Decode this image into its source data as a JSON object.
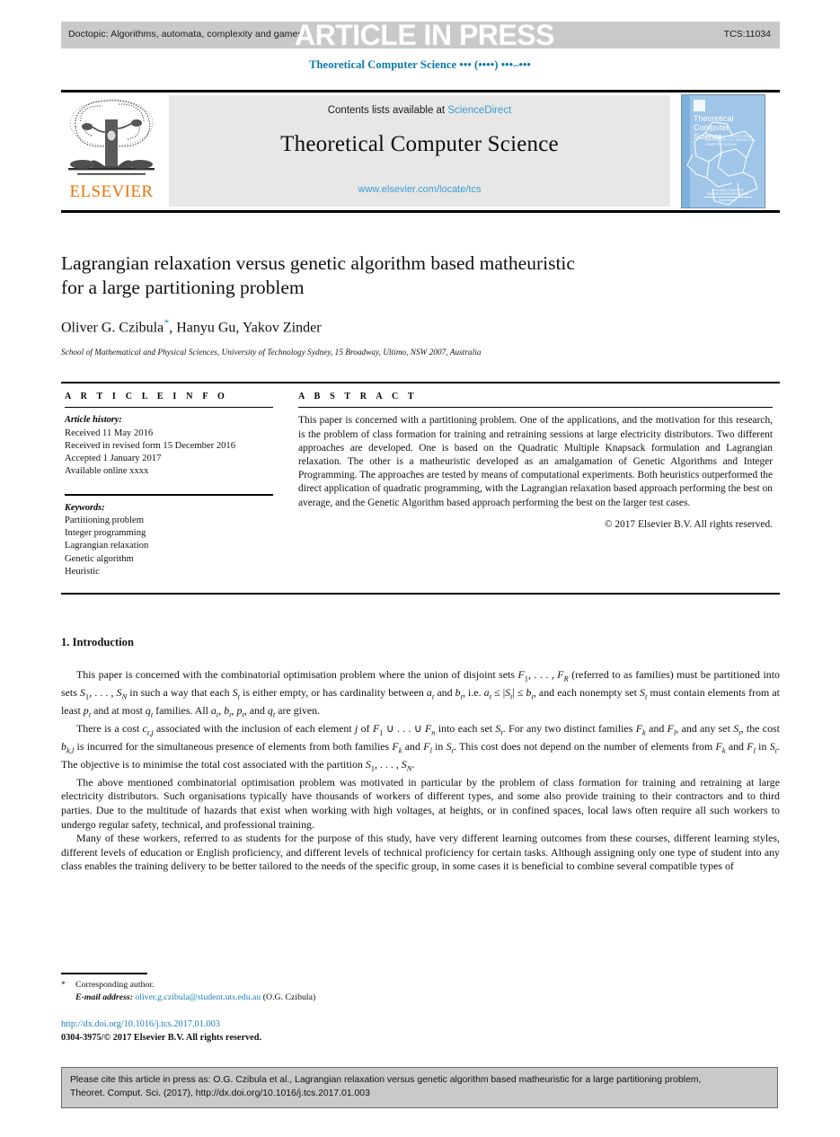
{
  "header": {
    "doctopic": "Doctopic: Algorithms, automata, complexity and games",
    "article_in_press": "ARTICLE IN PRESS",
    "tcs_number": "TCS:11034",
    "running_head": "Theoretical Computer Science ••• (••••) •••–•••"
  },
  "masthead": {
    "publisher": "ELSEVIER",
    "contents_prefix": "Contents lists available at ",
    "contents_link": "ScienceDirect",
    "journal_name": "Theoretical Computer Science",
    "journal_url": "www.elsevier.com/locate/tcs",
    "cover": {
      "title": "Theoretical Computer Science",
      "subtitle": "A JOURNAL OF THE EUROPEAN ASSOCIATION FOR THEORETICAL COMPUTER SCIENCE",
      "footer": "AVAILABLE ONLINE AT WWW.SCIENCEDIRECT.COM",
      "footer_brand": "ScienceDirect"
    }
  },
  "article": {
    "title": "Lagrangian relaxation versus genetic algorithm based matheuristic for a large partitioning problem",
    "authors": "Oliver G. Czibula",
    "authors_rest": ", Hanyu Gu, Yakov Zinder",
    "corresponding_marker": "*",
    "affiliation": "School of Mathematical and Physical Sciences, University of Technology Sydney, 15 Broadway, Ultimo, NSW 2007, Australia"
  },
  "article_info": {
    "heading": "A R T I C L E   I N F O",
    "history_label": "Article history:",
    "history": [
      "Received 11 May 2016",
      "Received in revised form 15 December 2016",
      "Accepted 1 January 2017",
      "Available online xxxx"
    ],
    "keywords_label": "Keywords:",
    "keywords": [
      "Partitioning problem",
      "Integer programming",
      "Lagrangian relaxation",
      "Genetic algorithm",
      "Heuristic"
    ]
  },
  "abstract": {
    "heading": "A B S T R A C T",
    "text": "This paper is concerned with a partitioning problem. One of the applications, and the motivation for this research, is the problem of class formation for training and retraining sessions at large electricity distributors. Two different approaches are developed. One is based on the Quadratic Multiple Knapsack formulation and Lagrangian relaxation. The other is a matheuristic developed as an amalgamation of Genetic Algorithms and Integer Programming. The approaches are tested by means of computational experiments. Both heuristics outperformed the direct application of quadratic programming, with the Lagrangian relaxation based approach performing the best on average, and the Genetic Algorithm based approach performing the best on the larger test cases.",
    "copyright": "© 2017 Elsevier B.V. All rights reserved."
  },
  "body": {
    "section_heading": "1. Introduction",
    "paragraphs": [
      "This paper is concerned with the combinatorial optimisation problem where the union of disjoint sets F1, . . . , FR (referred to as families) must be partitioned into sets S1, . . . , SN in such a way that each St is either empty, or has cardinality between at and bt, i.e. at ≤ |St| ≤ bt, and each nonempty set St must contain elements from at least pt and at most qt families. All at, bt, pt, and qt are given.",
      "There is a cost ct,j associated with the inclusion of each element j of F1 ∪ . . . ∪ Fn into each set St. For any two distinct families Fk and Fl, and any set St, the cost bk,l is incurred for the simultaneous presence of elements from both families Fk and Fl in St. This cost does not depend on the number of elements from Fk and Fl in St. The objective is to minimise the total cost associated with the partition S1, . . . , SN.",
      "The above mentioned combinatorial optimisation problem was motivated in particular by the problem of class formation for training and retraining at large electricity distributors. Such organisations typically have thousands of workers of different types, and some also provide training to their contractors and to third parties. Due to the multitude of hazards that exist when working with high voltages, at heights, or in confined spaces, local laws often require all such workers to undergo regular safety, technical, and professional training.",
      "Many of these workers, referred to as students for the purpose of this study, have very different learning outcomes from these courses, different learning styles, different levels of education or English proficiency, and different levels of technical proficiency for certain tasks. Although assigning only one type of student into any class enables the training delivery to be better tailored to the needs of the specific group, in some cases it is beneficial to combine several compatible types of"
    ]
  },
  "footnotes": {
    "corresponding_author": "Corresponding author.",
    "email_label": "E-mail address:",
    "email": "oliver.g.czibula@student.uts.edu.au",
    "email_owner": "(O.G. Czibula)",
    "doi_url": "http://dx.doi.org/10.1016/j.tcs.2017.01.003",
    "issn_line": "0304-3975/© 2017 Elsevier B.V. All rights reserved."
  },
  "cite_box": {
    "line1": "Please cite this article in press as: O.G. Czibula et al., Lagrangian relaxation versus genetic algorithm based matheuristic for a large partitioning problem,",
    "line2": "Theoret. Comput. Sci. (2017), http://dx.doi.org/10.1016/j.tcs.2017.01.003"
  },
  "colors": {
    "link_blue": "#1b7fb5",
    "science_direct_blue": "#3a9ed4",
    "elsevier_orange": "#ec7404",
    "band_gray": "#c9c9c9",
    "cover_blue": "#9fc5e8"
  }
}
